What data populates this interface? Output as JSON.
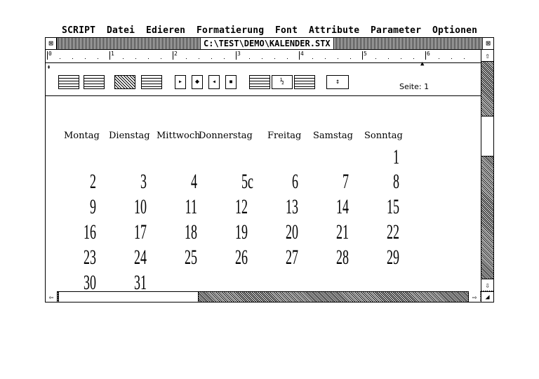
{
  "menu": [
    "SCRIPT",
    "Datei",
    "Edieren",
    "Formatierung",
    "Font",
    "Attribute",
    "Parameter",
    "Optionen"
  ],
  "window": {
    "title": "C:\\TEST\\DEMO\\KALENDER.STX"
  },
  "ruler": {
    "numbers": [
      "0",
      "1",
      "2",
      "3",
      "4",
      "5",
      "6"
    ]
  },
  "toolbar": {
    "page_label": "Seite: 1"
  },
  "calendar": {
    "weekdays": [
      "Montag",
      "Dienstag",
      "Mittwoch",
      "Donnerstag",
      "Freitag",
      "Samstag",
      "Sonntag"
    ],
    "weeks": [
      [
        "",
        "",
        "",
        "",
        "",
        "",
        "1"
      ],
      [
        "2",
        "3",
        "4",
        "5c",
        "6",
        "7",
        "8"
      ],
      [
        "9",
        "10",
        "11",
        "12",
        "13",
        "14",
        "15"
      ],
      [
        "16",
        "17",
        "18",
        "19",
        "20",
        "21",
        "22"
      ],
      [
        "23",
        "24",
        "25",
        "26",
        "27",
        "28",
        "29"
      ],
      [
        "30",
        "31",
        "",
        "",
        "",
        "",
        ""
      ]
    ]
  },
  "icons": {
    "close": "close-box-icon",
    "full": "fullsize-box-icon",
    "up": "arrow-up-icon",
    "down": "arrow-down-icon",
    "left": "arrow-left-icon",
    "right": "arrow-right-icon",
    "resize": "resize-box-icon"
  }
}
